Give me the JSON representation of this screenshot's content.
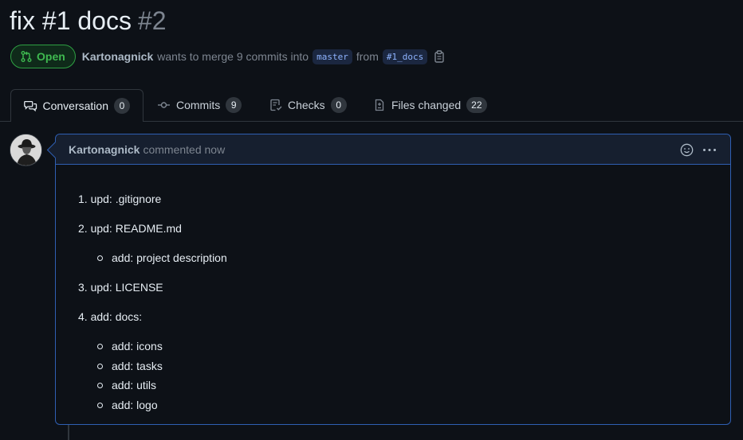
{
  "pr": {
    "title": "fix #1 docs",
    "number": "#2",
    "state": "Open",
    "author": "Kartonagnick",
    "merge_text": "wants to merge 9 commits into",
    "base_branch": "master",
    "from_text": "from",
    "head_branch": "#1_docs"
  },
  "tabs": [
    {
      "label": "Conversation",
      "count": "0",
      "icon": "comment-discussion-icon"
    },
    {
      "label": "Commits",
      "count": "9",
      "icon": "git-commit-icon"
    },
    {
      "label": "Checks",
      "count": "0",
      "icon": "checklist-icon"
    },
    {
      "label": "Files changed",
      "count": "22",
      "icon": "file-diff-icon"
    }
  ],
  "comment": {
    "author": "Kartonagnick",
    "action": "commented now",
    "items": [
      {
        "num": "1.",
        "text": "upd: .gitignore",
        "sub": []
      },
      {
        "num": "2.",
        "text": "upd: README.md",
        "sub": [
          "add: project description"
        ]
      },
      {
        "num": "3.",
        "text": "upd: LICENSE",
        "sub": []
      },
      {
        "num": "4.",
        "text": "add: docs:",
        "sub": [
          "add: icons",
          "add: tasks",
          "add: utils",
          "add: logo"
        ]
      }
    ]
  },
  "colors": {
    "background": "#0d1117",
    "open_green": "#3fb950",
    "comment_border": "#2f5fb3",
    "muted": "#7d8590"
  }
}
